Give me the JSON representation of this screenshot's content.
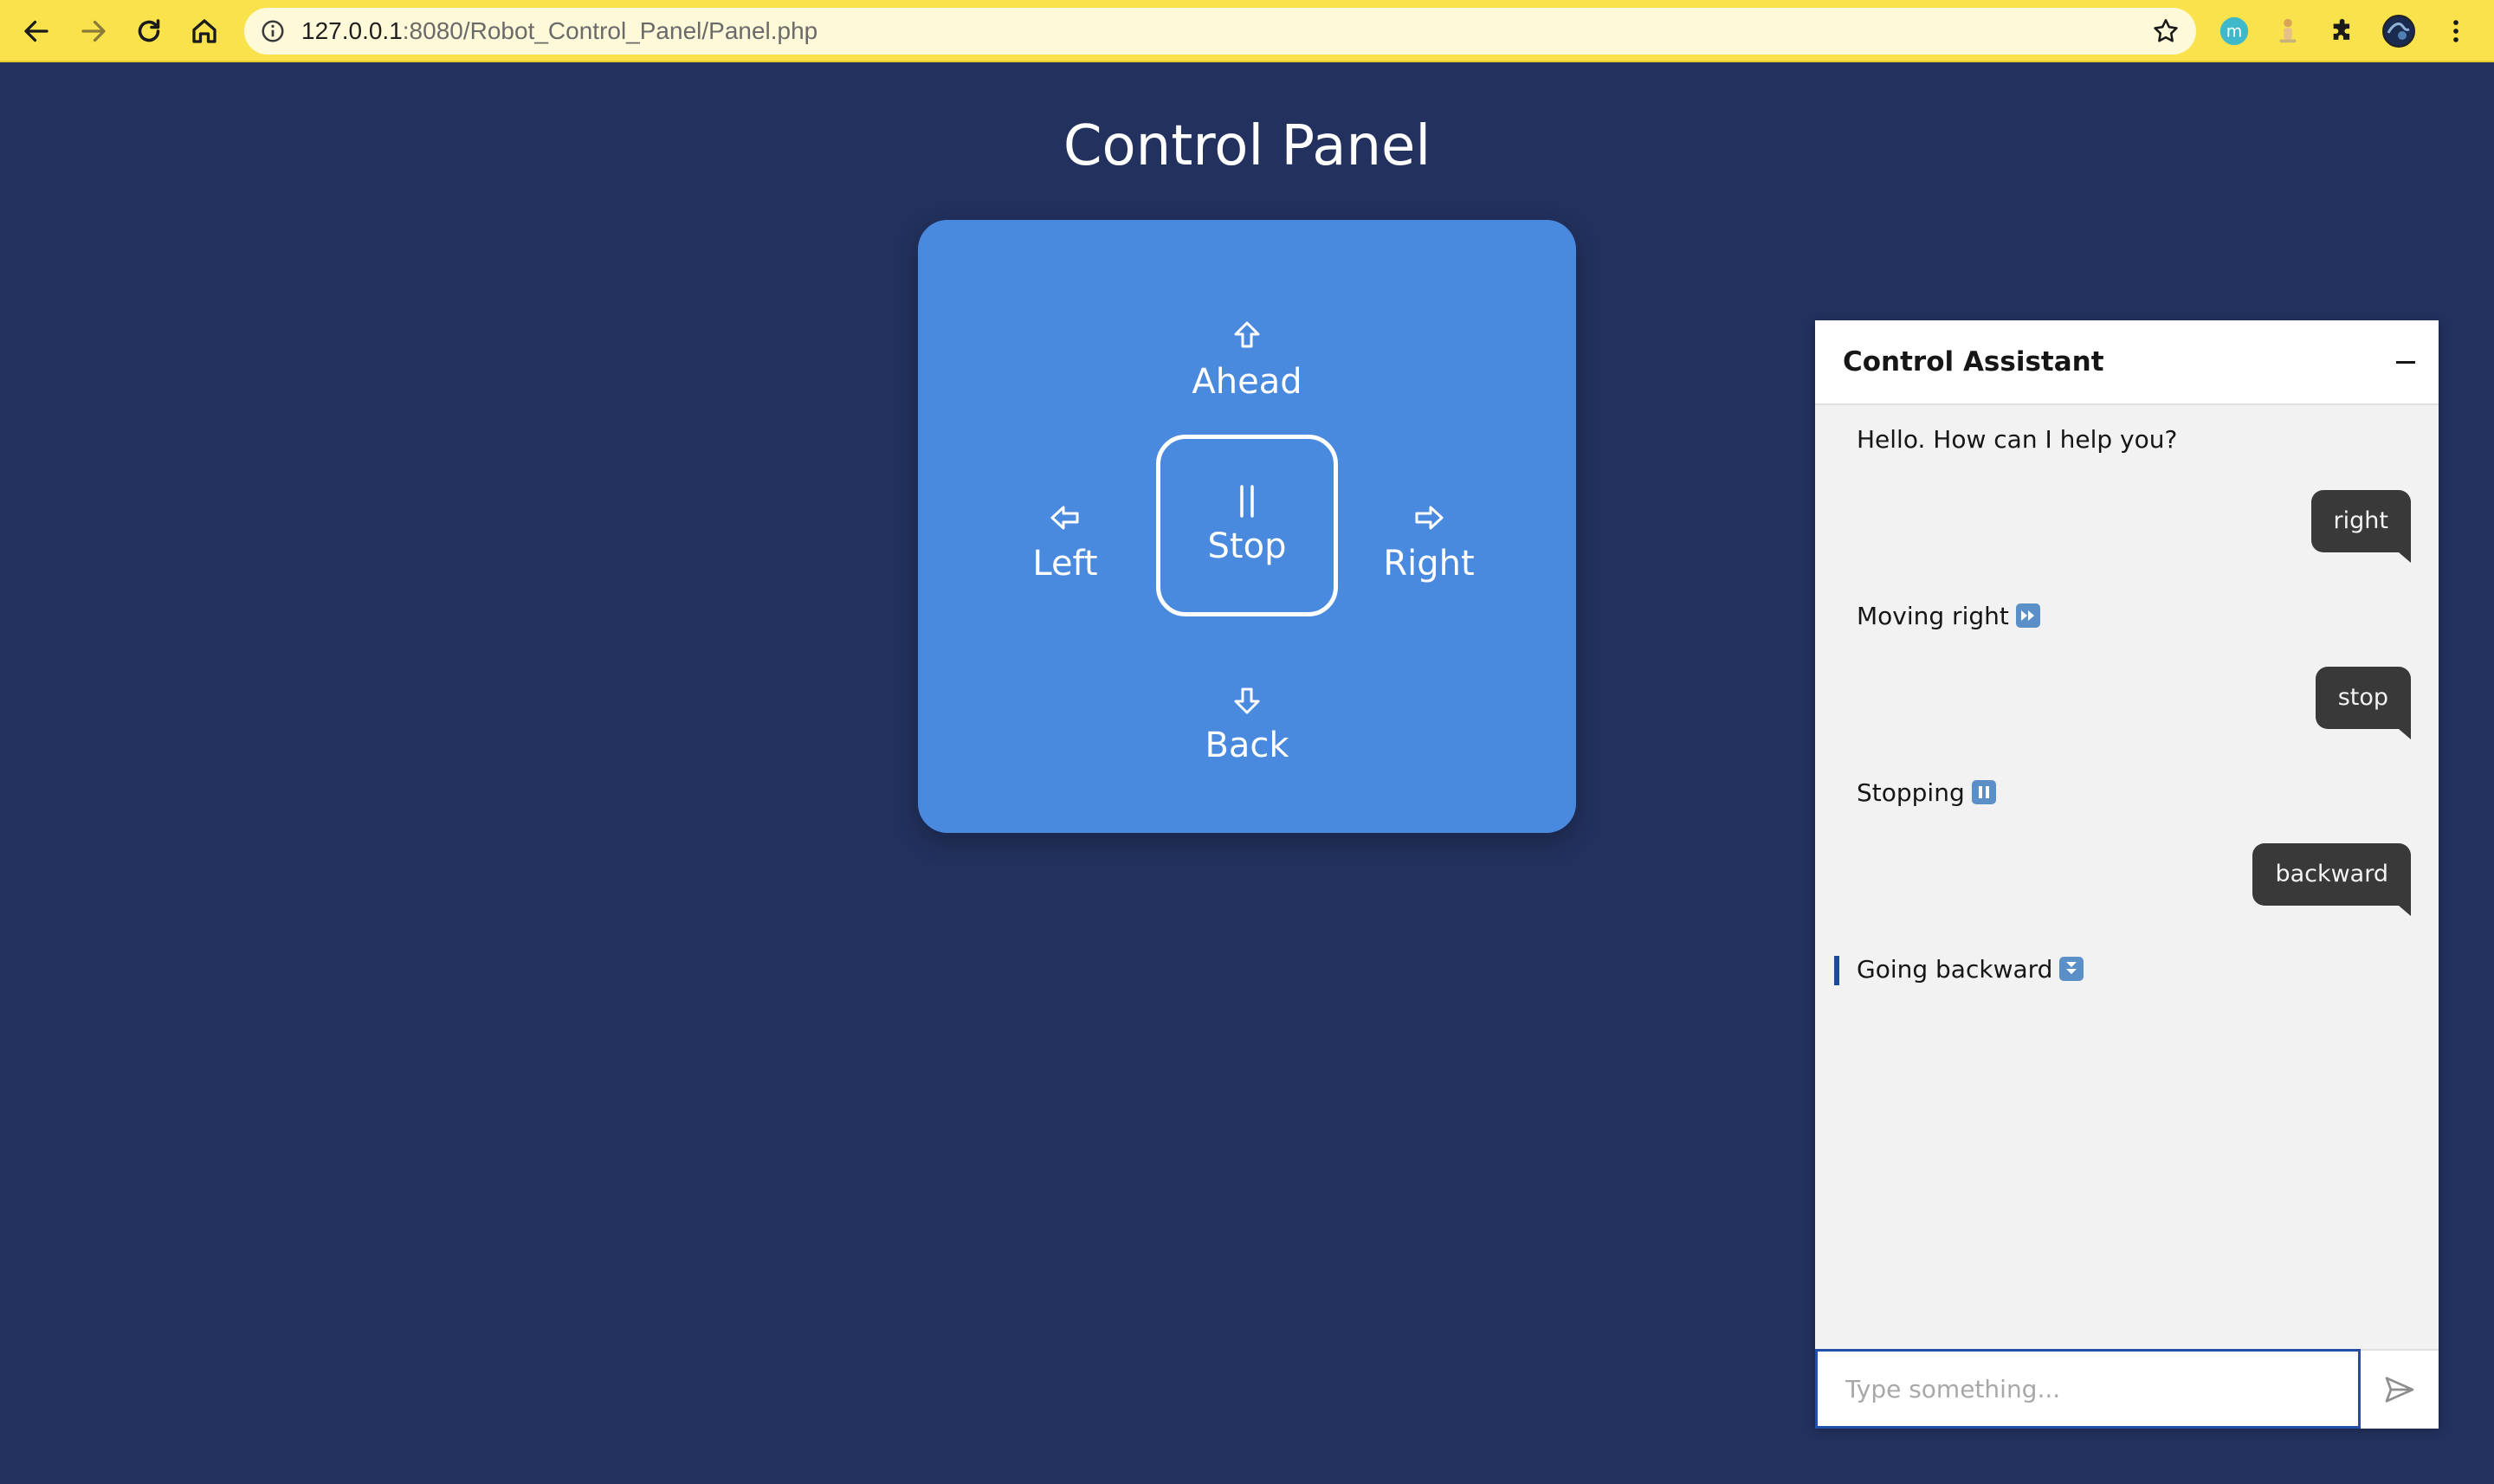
{
  "browser": {
    "url_host": "127.0.0.1",
    "url_path": ":8080/Robot_Control_Panel/Panel.php",
    "nav_icons": [
      "back-arrow-icon",
      "forward-arrow-icon",
      "reload-icon",
      "home-icon"
    ],
    "extension_icons": [
      "m-extension-icon",
      "figure-extension-icon",
      "puzzle-icon",
      "profile-avatar",
      "kebab-menu-icon"
    ],
    "profile_letter": "m"
  },
  "page": {
    "title": "Control Panel"
  },
  "controls": {
    "ahead": {
      "label": "Ahead",
      "icon": "arrow-up-icon"
    },
    "left": {
      "label": "Left",
      "icon": "arrow-left-icon"
    },
    "stop": {
      "label": "Stop",
      "icon": "pause-icon"
    },
    "right": {
      "label": "Right",
      "icon": "arrow-right-icon"
    },
    "back": {
      "label": "Back",
      "icon": "arrow-down-icon"
    }
  },
  "chat": {
    "title": "Control Assistant",
    "messages": [
      {
        "from": "bot",
        "text": "Hello. How can I help you?"
      },
      {
        "from": "user",
        "text": "right"
      },
      {
        "from": "bot",
        "text": "Moving right",
        "emoji": "fast-forward-emoji"
      },
      {
        "from": "user",
        "text": "stop"
      },
      {
        "from": "bot",
        "text": "Stopping",
        "emoji": "pause-emoji"
      },
      {
        "from": "user",
        "text": "backward"
      },
      {
        "from": "bot",
        "text": "Going backward",
        "emoji": "fast-down-emoji"
      }
    ],
    "input_value": "",
    "input_placeholder": "Type something..."
  },
  "colors": {
    "page_background": "#22315d",
    "browser_bar": "#f9e24b",
    "pad_background": "#4a8ade",
    "user_bubble": "#393939",
    "input_focus": "#1f4fa8"
  }
}
